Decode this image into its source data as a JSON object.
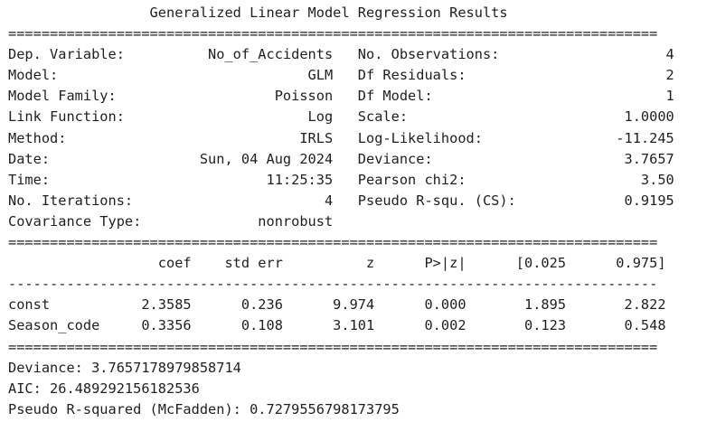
{
  "title": "                 Generalized Linear Model Regression Results",
  "rule_double": "==============================================================================",
  "rule_single": "------------------------------------------------------------------------------",
  "summary_rows": [
    "Dep. Variable:          No_of_Accidents   No. Observations:                    4",
    "Model:                              GLM   Df Residuals:                        2",
    "Model Family:                   Poisson   Df Model:                            1",
    "Link Function:                      Log   Scale:                          1.0000",
    "Method:                            IRLS   Log-Likelihood:                -11.245",
    "Date:                  Sun, 04 Aug 2024   Deviance:                       3.7657",
    "Time:                          11:25:35   Pearson chi2:                     3.50",
    "No. Iterations:                       4   Pseudo R-squ. (CS):             0.9195",
    "Covariance Type:              nonrobust"
  ],
  "coef_header": "                  coef    std err          z      P>|z|      [0.025      0.975]",
  "coef_rows": [
    "const           2.3585      0.236      9.974      0.000       1.895       2.822",
    "Season_code     0.3356      0.108      3.101      0.002       0.123       0.548"
  ],
  "footer": [
    "Deviance: 3.7657178979858714",
    "AIC: 26.489292156182536",
    "Pseudo R-squared (McFadden): 0.7279556798173795"
  ]
}
